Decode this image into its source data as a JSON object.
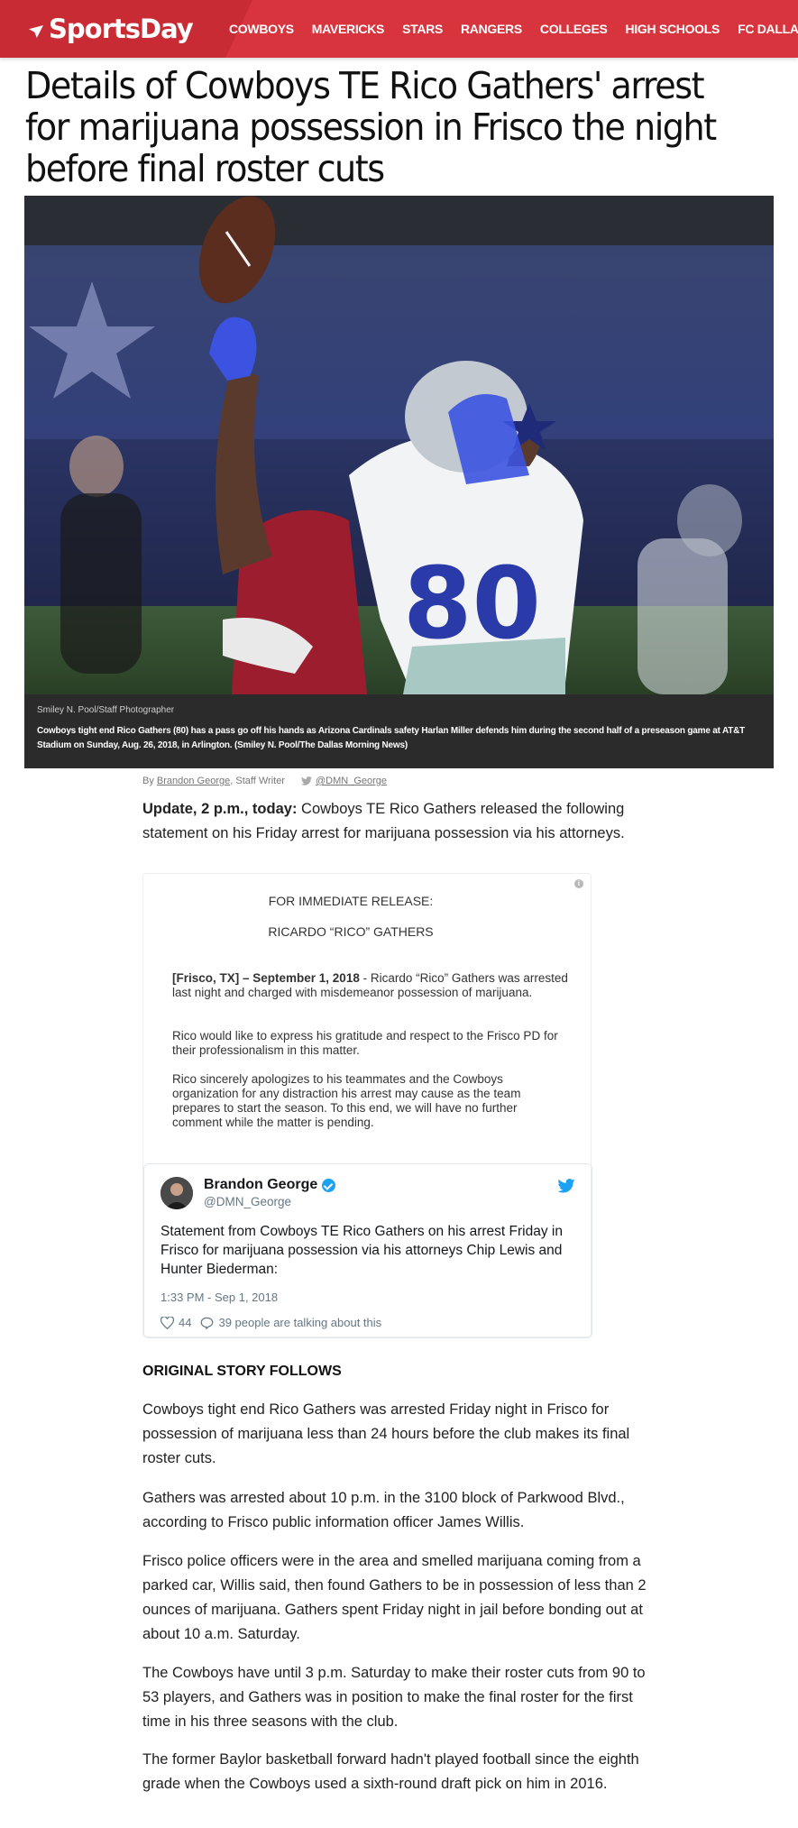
{
  "site": {
    "logo": "SportsDay",
    "nav": [
      "COWBOYS",
      "MAVERICKS",
      "STARS",
      "RANGERS",
      "COLLEGES",
      "HIGH SCHOOLS",
      "FC DALLAS"
    ]
  },
  "article": {
    "headline": "Details of Cowboys TE Rico Gathers' arrest for marijuana possession in Frisco the night before final roster cuts",
    "photo": {
      "credit": "Smiley N. Pool/Staff Photographer",
      "caption": "Cowboys tight end Rico Gathers (80) has a pass go off his hands as Arizona Cardinals safety Harlan Miller defends him during the second half of a preseason game at AT&T Stadium on Sunday, Aug. 26, 2018, in Arlington. (Smiley N. Pool/The Dallas Morning News)",
      "jersey_number": "80"
    },
    "byline": {
      "prefix": "By",
      "author": "Brandon George",
      "role": ", Staff Writer",
      "twitter": "@DMN_George"
    },
    "update_label": "Update, 2 p.m., today:",
    "update_text": " Cowboys TE Rico Gathers released the following statement on his Friday arrest for marijuana possession via his attorneys.",
    "section_head": "ORIGINAL STORY FOLLOWS",
    "paragraphs": [
      "Cowboys tight end Rico Gathers was arrested Friday night in Frisco for possession of marijuana less than 24 hours before the club makes its final roster cuts.",
      "Gathers was arrested about 10 p.m. in the 3100 block of Parkwood Blvd., according to Frisco public information officer James Willis.",
      "Frisco police officers were in the area and smelled marijuana coming from a parked car, Willis said, then found Gathers to be in possession of less than 2 ounces of marijuana. Gathers spent Friday night in jail before bonding out at about 10 a.m. Saturday.",
      "The Cowboys have until 3 p.m. Saturday to make their roster cuts from 90 to 53 players, and Gathers was in position to make the final roster for the first time in his three seasons with the club.",
      "The former Baylor basketball forward hadn't played football since the eighth grade when the Cowboys used a sixth-round draft pick on him in 2016."
    ]
  },
  "release": {
    "line1": "FOR IMMEDIATE RELEASE:",
    "line2": "RICARDO “RICO” GATHERS",
    "dateline": "[Frisco, TX] – September 1, 2018",
    "p1": "  - Ricardo “Rico” Gathers was arrested last night and charged with misdemeanor possession of marijuana.",
    "p2": "Rico would like to express his gratitude and respect to the Frisco PD for their professionalism in this matter.",
    "p3": "Rico sincerely apologizes to his teammates and the Cowboys organization for any distraction his arrest may cause as the team prepares to start the season.  To this end, we will have no further comment while the matter is pending."
  },
  "tweet": {
    "name": "Brandon George",
    "handle": "@DMN_George",
    "text": "Statement from Cowboys TE Rico Gathers on his arrest Friday in Frisco for marijuana possession via his attorneys Chip Lewis and Hunter Biederman:",
    "time": "1:33 PM - Sep 1, 2018",
    "likes": "44",
    "talking": "39 people are talking about this",
    "info_icon_glyph": "i"
  },
  "colors": {
    "brand_red": "#d7343e",
    "twitter_blue": "#1da1f2",
    "cowboys_blue": "#2a3aa8"
  }
}
